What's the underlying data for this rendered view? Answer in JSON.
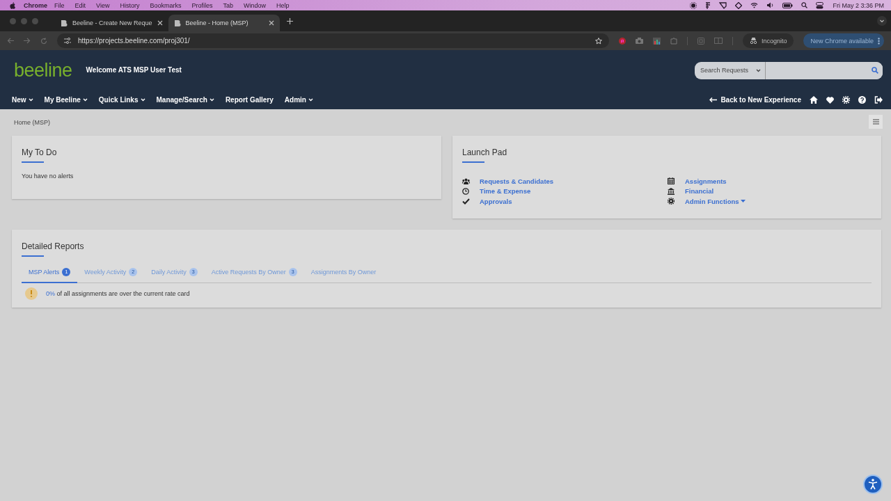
{
  "os_menu_bar": {
    "app": "Chrome",
    "menus": [
      "File",
      "Edit",
      "View",
      "History",
      "Bookmarks",
      "Profiles",
      "Tab",
      "Window",
      "Help"
    ],
    "clock": "Fri May 2  3:36 PM"
  },
  "browser": {
    "tabs": [
      {
        "title": "Beeline - Create New Reque",
        "selected": false
      },
      {
        "title": "Beeline - Home (MSP)",
        "selected": true
      }
    ],
    "url": "https://projects.beeline.com/proj301/",
    "profile": "Incognito",
    "update_button": "New Chrome available"
  },
  "header": {
    "logo": "beeline",
    "welcome": "Welcome ATS MSP User Test",
    "search_select": "Search Requests",
    "nav": [
      {
        "label": "New",
        "dropdown": true
      },
      {
        "label": "My Beeline",
        "dropdown": true
      },
      {
        "label": "Quick Links",
        "dropdown": true
      },
      {
        "label": "Manage/Search",
        "dropdown": true
      },
      {
        "label": "Report Gallery",
        "dropdown": false
      },
      {
        "label": "Admin",
        "dropdown": true
      }
    ],
    "back_link": "Back to New Experience"
  },
  "breadcrumb": "Home (MSP)",
  "todo": {
    "title": "My To Do",
    "message": "You have no alerts"
  },
  "launch_pad": {
    "title": "Launch Pad",
    "links": [
      {
        "label": "Requests & Candidates",
        "dropdown": false
      },
      {
        "label": "Time & Expense",
        "dropdown": false
      },
      {
        "label": "Approvals",
        "dropdown": false
      },
      {
        "label": "Assignments",
        "dropdown": false
      },
      {
        "label": "Financial",
        "dropdown": false
      },
      {
        "label": "Admin Functions",
        "dropdown": true
      }
    ]
  },
  "reports": {
    "title": "Detailed Reports",
    "tabs": [
      {
        "label": "MSP Alerts",
        "count": "1",
        "selected": true
      },
      {
        "label": "Weekly Activity",
        "count": "2",
        "selected": false
      },
      {
        "label": "Daily Activity",
        "count": "3",
        "selected": false
      },
      {
        "label": "Active Requests By Owner",
        "count": "3",
        "selected": false
      },
      {
        "label": "Assignments By Owner",
        "selected": false
      }
    ],
    "alert": {
      "link": "0%",
      "text": "of all assignments are over the current rate card"
    }
  }
}
